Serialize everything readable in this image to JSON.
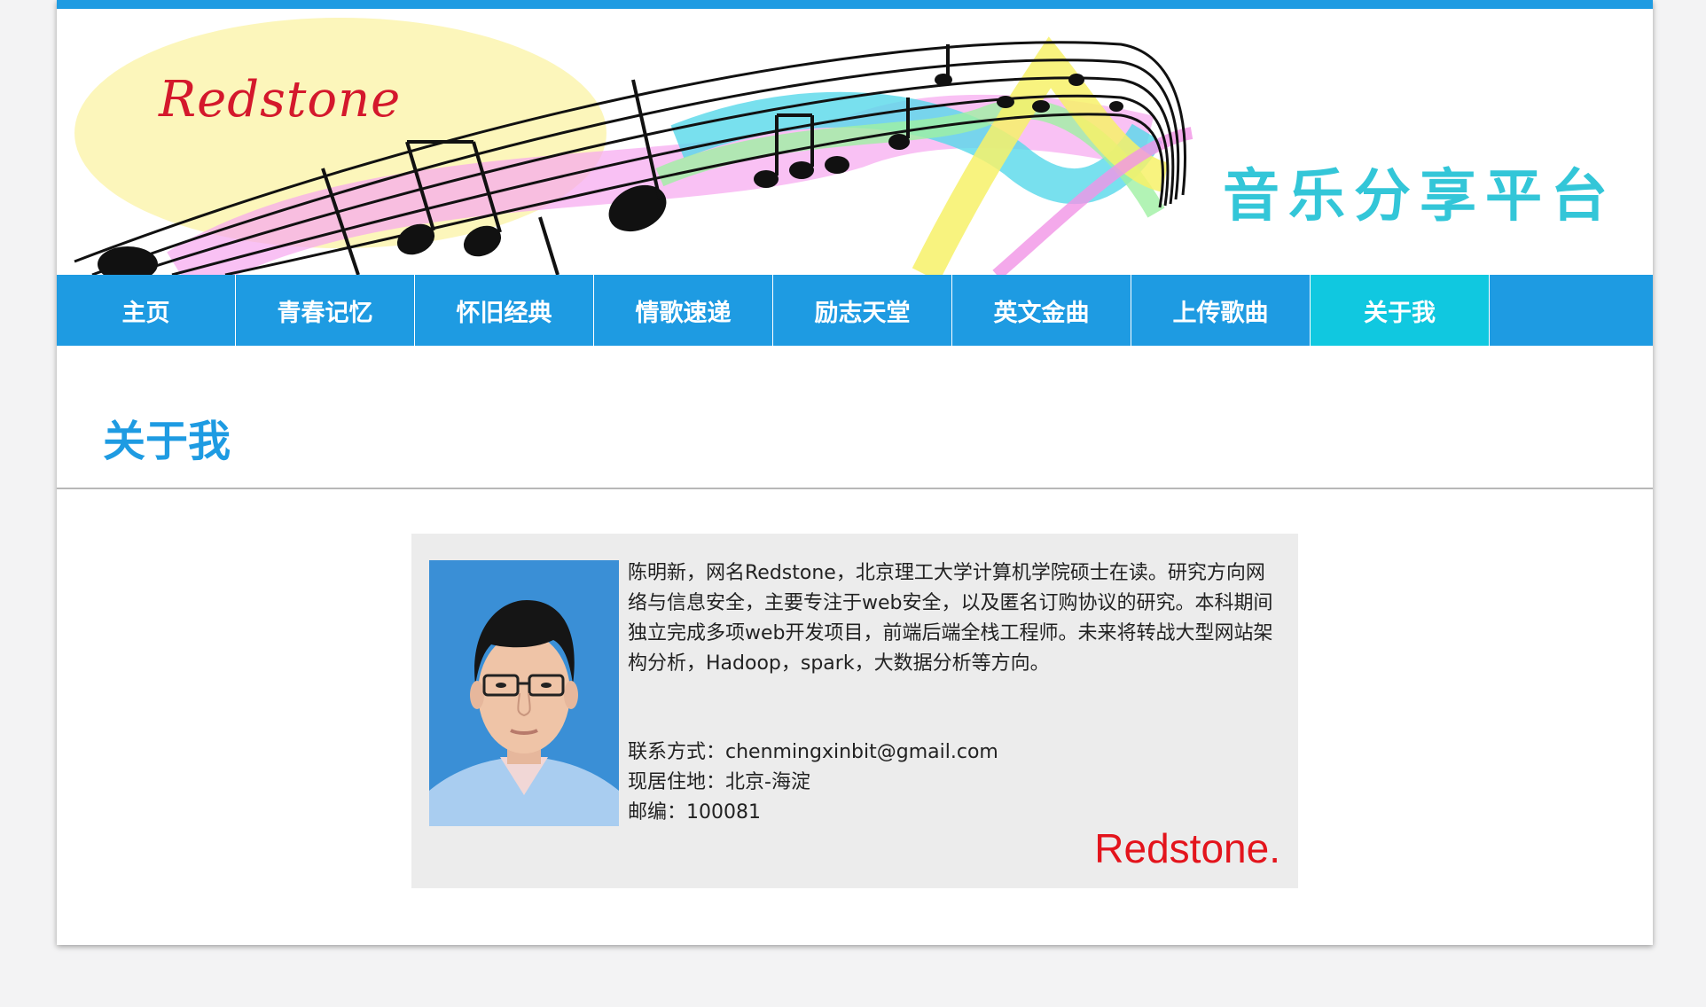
{
  "banner": {
    "logo_text": "Redstone",
    "slogan": "音乐分享平台"
  },
  "nav": {
    "items": [
      {
        "label": "主页"
      },
      {
        "label": "青春记忆"
      },
      {
        "label": "怀旧经典"
      },
      {
        "label": "情歌速递"
      },
      {
        "label": "励志天堂"
      },
      {
        "label": "英文金曲"
      },
      {
        "label": "上传歌曲"
      },
      {
        "label": "关于我"
      }
    ],
    "active_index": 7
  },
  "page": {
    "title": "关于我"
  },
  "profile": {
    "bio": "陈明新，网名Redstone，北京理工大学计算机学院硕士在读。研究方向网络与信息安全，主要专注于web安全，以及匿名订购协议的研究。本科期间独立完成多项web开发项目，前端后端全栈工程师。未来将转战大型网站架构分析，Hadoop，spark，大数据分析等方向。",
    "contact": "联系方式：chenmingxinbit@gmail.com",
    "address": "现居住地：北京-海淀",
    "postcode": "邮编：100081",
    "signature": "Redstone."
  },
  "colors": {
    "accent": "#1e9be2",
    "nav_active": "#10c8e0",
    "slogan": "#33c6d8",
    "logo": "#d4182c",
    "signature": "#e3141c",
    "card_bg": "#ececec"
  }
}
